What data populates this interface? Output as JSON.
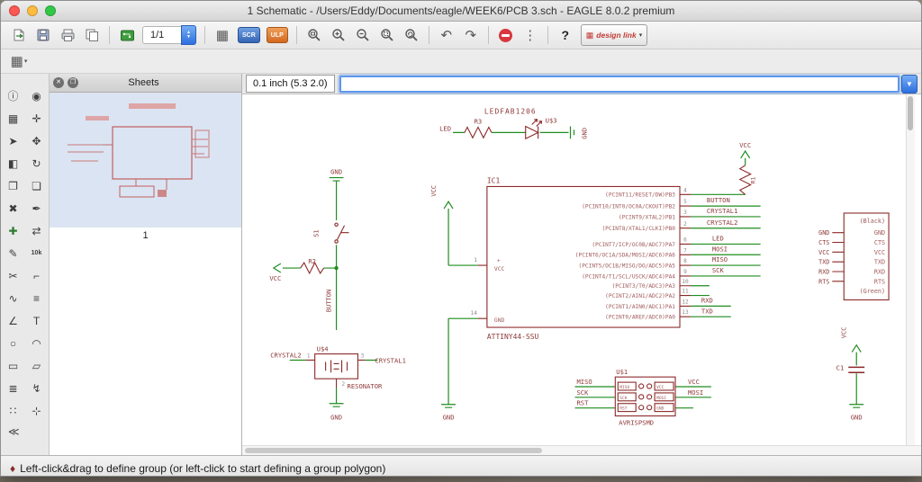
{
  "window": {
    "title": "1 Schematic - /Users/Eddy/Documents/eagle/WEEK6/PCB 3.sch - EAGLE 8.0.2 premium"
  },
  "toolbar": {
    "sheet_selector": "1/1",
    "scr": "SCR",
    "ulp": "ULP",
    "undo": "↶",
    "redo": "↷",
    "more": "⋮",
    "help": "?",
    "design_link": "design link",
    "design_link_logo": "▦",
    "grid_glyph": "▦",
    "caret": "▾"
  },
  "coord_bar": {
    "position": "0.1 inch (5.3 2.0)",
    "command_value": ""
  },
  "sheets": {
    "title": "Sheets",
    "close_glyph": "✕",
    "float_glyph": "❐",
    "selected_label": "1"
  },
  "status": {
    "icon": "♦",
    "text": "Left-click&drag to define group (or left-click to start defining a group polygon)"
  },
  "palette": {
    "collapse_glyph": "≪",
    "tools": [
      {
        "name": "info-tool",
        "glyph": "ⓘ"
      },
      {
        "name": "show-tool",
        "glyph": "◉"
      },
      {
        "name": "display-layers-tool",
        "glyph": "▦"
      },
      {
        "name": "mark-tool",
        "glyph": "✛"
      },
      {
        "name": "group-select-tool",
        "glyph": "➤"
      },
      {
        "name": "move-tool",
        "glyph": "✥"
      },
      {
        "name": "mirror-tool",
        "glyph": "◧"
      },
      {
        "name": "rotate-tool",
        "glyph": "↻"
      },
      {
        "name": "copy-tool",
        "glyph": "❐"
      },
      {
        "name": "paste-tool",
        "glyph": "❏"
      },
      {
        "name": "delete-tool",
        "glyph": "✖"
      },
      {
        "name": "change-tool",
        "glyph": "✒"
      },
      {
        "name": "add-part-tool",
        "glyph": "✚",
        "color": "#2e7d32"
      },
      {
        "name": "pinswap-tool",
        "glyph": "⇄"
      },
      {
        "name": "name-tool",
        "glyph": "✎"
      },
      {
        "name": "value-tool",
        "glyph": "10k",
        "small": true
      },
      {
        "name": "smash-tool",
        "glyph": "✂"
      },
      {
        "name": "miter-tool",
        "glyph": "⌐"
      },
      {
        "name": "split-tool",
        "glyph": "∿"
      },
      {
        "name": "invoke-tool",
        "glyph": "≡"
      },
      {
        "name": "wire-tool",
        "glyph": "∠"
      },
      {
        "name": "text-tool",
        "glyph": "T"
      },
      {
        "name": "circle-tool",
        "glyph": "○"
      },
      {
        "name": "arc-tool",
        "glyph": "◠"
      },
      {
        "name": "rect-tool",
        "glyph": "▭"
      },
      {
        "name": "polygon-tool",
        "glyph": "▱"
      },
      {
        "name": "bus-tool",
        "glyph": "≣"
      },
      {
        "name": "net-tool",
        "glyph": "↯"
      },
      {
        "name": "junction-tool",
        "glyph": "∷"
      },
      {
        "name": "label-tool",
        "glyph": "⊹"
      }
    ]
  },
  "schematic": {
    "led": {
      "net": "LED",
      "r": "R3",
      "part": "LEDFAB1206",
      "ref": "U$3",
      "gnd": "GND"
    },
    "btn": {
      "gnd": "GND",
      "s1": "S1",
      "r2": "R2",
      "vcc": "VCC",
      "net": "BUTTON"
    },
    "ic1": {
      "ref": "IC1",
      "part": "ATTINY44-SSU",
      "pin1": "1",
      "pin14": "14",
      "plus": "+",
      "vcc_in": "VCC",
      "gnd_in": "GND",
      "vcc_wire": "VCC",
      "gnd_wire": "GND",
      "pins": [
        "(PCINT11/RESET/DW)PB3",
        "(PCINT10/INT0/OC0A/CKOUT)PB2",
        "(PCINT9/XTAL2)PB1",
        "(PCINT8/XTAL1/CLKI)PB0",
        "(PCINT7/ICP/OC0B/ADC7)PA7",
        "(PCINT6/OC1A/SDA/MOSI/ADC6)PA6",
        "(PCINT5/OC1B/MISO/DO/ADC5)PA5",
        "(PCINT4/T1/SCL/USCK/ADC4)PA4",
        "(PCINT3/T0/ADC3)PA3",
        "(PCINT2/AIN1/ADC2)PA2",
        "(PCINT1/AIN0/ADC1)PA1",
        "(PCINT0/AREF/ADC0)PA0"
      ],
      "nums": [
        "4",
        "5",
        "3",
        "2",
        "6",
        "7",
        "8",
        "9",
        "10",
        "11",
        "12",
        "13"
      ],
      "nets": [
        "BUTTON",
        "CRYSTAL1",
        "CRYSTAL2",
        "LED",
        "MOSI",
        "MISO",
        "SCK",
        "RXD",
        "TXD"
      ]
    },
    "r1": {
      "vcc": "VCC",
      "ref": "R1"
    },
    "ftdi": {
      "top": "(Black)",
      "bottom": "(Green)",
      "left": [
        "GND",
        "CTS",
        "VCC",
        "TXD",
        "RXD",
        "RTS"
      ],
      "right": [
        "GND",
        "CTS",
        "VCC",
        "TXD",
        "RXD",
        "RTS"
      ]
    },
    "res": {
      "ref": "U$4",
      "part": "RESONATOR",
      "left": "CRYSTAL2",
      "right": "CRYSTAL1",
      "p1": "1",
      "p2": "2",
      "p3": "3",
      "gnd": "GND"
    },
    "isp": {
      "ref": "U$1",
      "part": "AVRISPSMD",
      "left": [
        "MISO",
        "SCK",
        "RST"
      ],
      "right": [
        "VCC",
        "MOSI"
      ],
      "inner_left": [
        "MISO",
        "SCK",
        "RST"
      ],
      "inner_right": [
        "VCC",
        "MOSI",
        "GND"
      ]
    },
    "c1": {
      "ref": "C1",
      "vcc": "VCC",
      "gnd": "GND"
    }
  }
}
